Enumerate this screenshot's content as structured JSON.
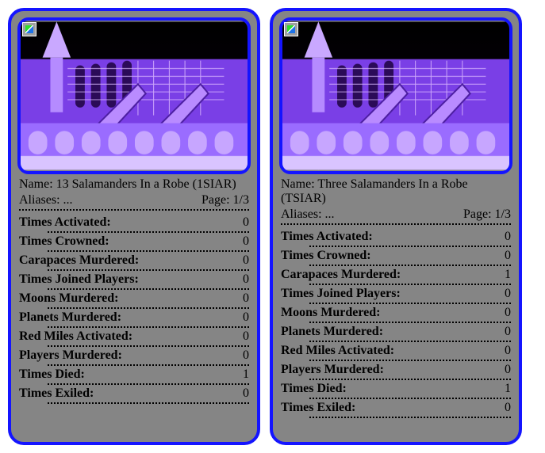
{
  "labels": {
    "name_prefix": "Name: ",
    "aliases_prefix": "Aliases: ",
    "page_prefix": "Page: "
  },
  "stat_labels": [
    "Times Activated:",
    "Times Crowned:",
    "Carapaces Murdered:",
    "Times Joined Players:",
    "Moons Murdered:",
    "Planets Murdered:",
    "Red Miles Activated:",
    "Players Murdered:",
    "Times Died:",
    "Times Exiled:"
  ],
  "cards": [
    {
      "name": "13 Salamanders In a Robe (1SIAR)",
      "aliases": "...",
      "page": "1/3",
      "values": [
        0,
        0,
        0,
        0,
        0,
        0,
        0,
        0,
        1,
        0
      ]
    },
    {
      "name": "Three Salamanders In a Robe (TSIAR)",
      "aliases": "...",
      "page": "1/3",
      "values": [
        0,
        0,
        1,
        0,
        0,
        0,
        0,
        0,
        1,
        0
      ]
    }
  ],
  "art": {
    "svg_defs": "gothic-cathedral-purple"
  }
}
